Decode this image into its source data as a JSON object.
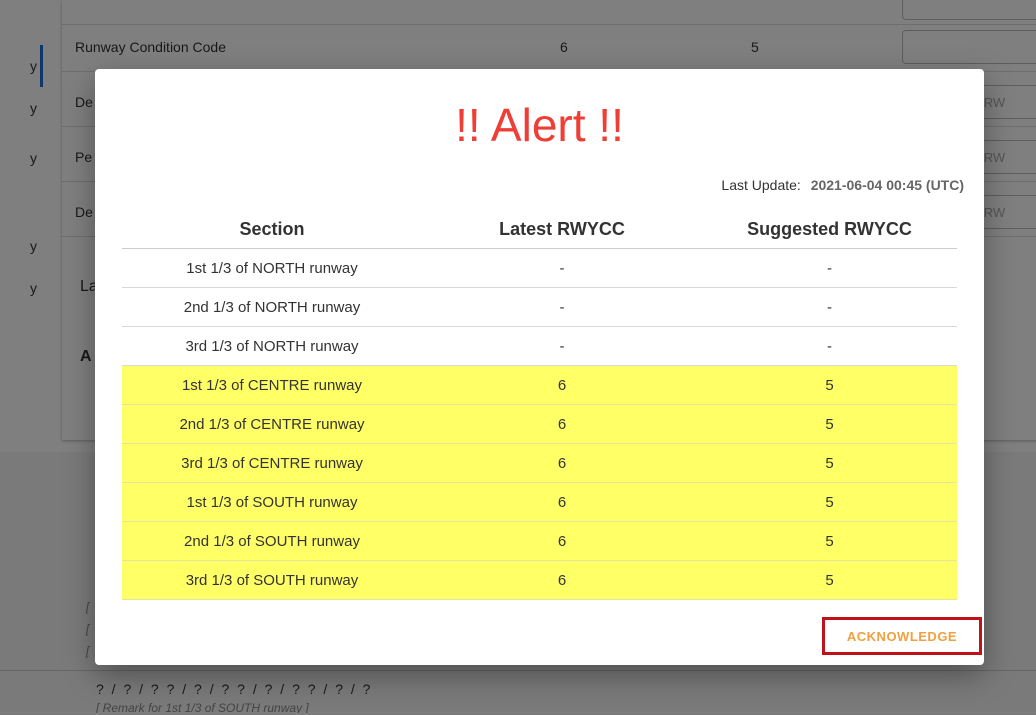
{
  "background": {
    "row_label": "Runway Condition Code",
    "row_latest": "6",
    "row_suggested": "5",
    "row_stubs": [
      "De",
      "Pe",
      "De"
    ],
    "input_stub": "ter RW",
    "left_marks": [
      "y",
      "y",
      "y",
      "y",
      "y"
    ],
    "section_stub": "La",
    "section_stub2": "A",
    "question_marks": "? / ? / ?    ? / ? / ?    ? / ? / ?    ? / ? / ?",
    "remark": "[ Remark for 1st 1/3 of SOUTH runway ]",
    "bracket_stub": "["
  },
  "dialog": {
    "title": "!! Alert !!",
    "last_update_label": "Last Update:",
    "last_update_value": "2021-06-04 00:45 (UTC)",
    "columns": [
      "Section",
      "Latest RWYCC",
      "Suggested RWYCC"
    ],
    "rows": [
      {
        "section": "1st 1/3 of NORTH runway",
        "latest": "-",
        "suggested": "-",
        "highlight": false
      },
      {
        "section": "2nd 1/3 of NORTH runway",
        "latest": "-",
        "suggested": "-",
        "highlight": false
      },
      {
        "section": "3rd 1/3 of NORTH runway",
        "latest": "-",
        "suggested": "-",
        "highlight": false
      },
      {
        "section": "1st 1/3 of CENTRE runway",
        "latest": "6",
        "suggested": "5",
        "highlight": true
      },
      {
        "section": "2nd 1/3 of CENTRE runway",
        "latest": "6",
        "suggested": "5",
        "highlight": true
      },
      {
        "section": "3rd 1/3 of CENTRE runway",
        "latest": "6",
        "suggested": "5",
        "highlight": true
      },
      {
        "section": "1st 1/3 of SOUTH runway",
        "latest": "6",
        "suggested": "5",
        "highlight": true
      },
      {
        "section": "2nd 1/3 of SOUTH runway",
        "latest": "6",
        "suggested": "5",
        "highlight": true
      },
      {
        "section": "3rd 1/3 of SOUTH runway",
        "latest": "6",
        "suggested": "5",
        "highlight": true
      }
    ],
    "acknowledge_label": "ACKNOWLEDGE"
  },
  "colors": {
    "alert": "#ef3e36",
    "highlight_row": "#ffff66",
    "ack_text": "#f0a040",
    "ack_border": "#c0121b"
  }
}
